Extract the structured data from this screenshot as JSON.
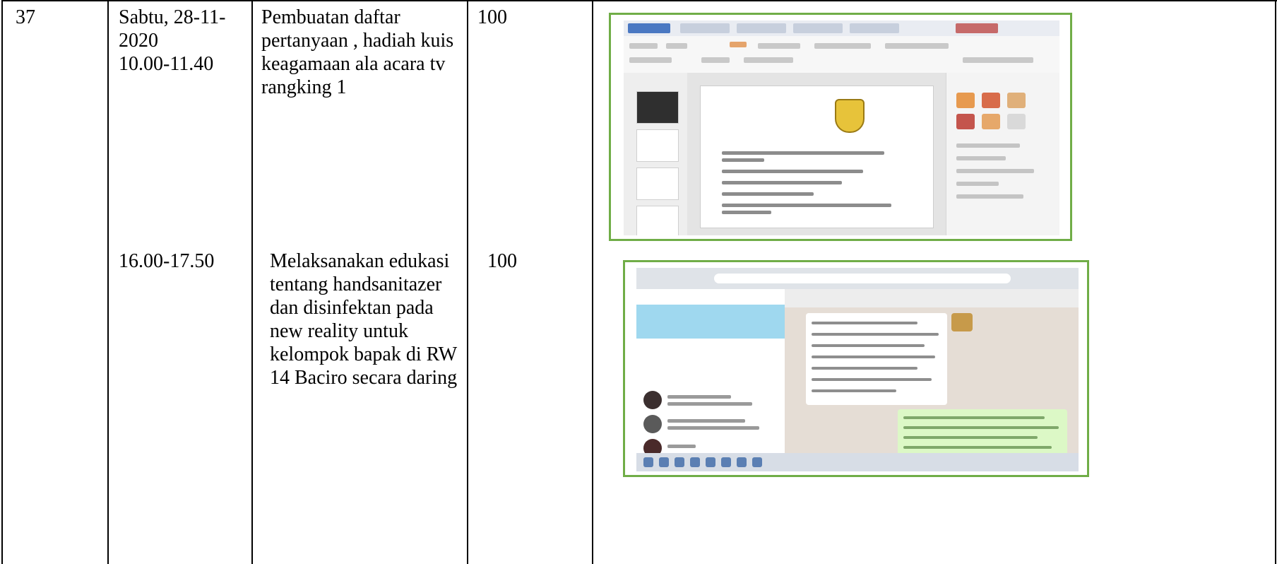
{
  "rows": [
    {
      "number": "37",
      "date_time": "Sabtu, 28-11-\n2020\n10.00-11.40",
      "activity": "Pembuatan daftar\npertanyaan , hadiah kuis\nkeagamaan ala acara tv\nrangking 1",
      "score": "100",
      "evidence": "presentation-editor-screenshot"
    },
    {
      "number": "",
      "date_time": "16.00-17.50",
      "activity": "Melaksanakan edukasi\ntentang handsanitazer\ndan   disinfektan pada\nnew reality untuk\nkelompok bapak di RW\n14 Baciro secara daring",
      "score": "100",
      "evidence": "chat-app-screenshot"
    }
  ],
  "colors": {
    "frame_border": "#70ad47",
    "grid": "#000000",
    "chat_banner": "#9fd8ef",
    "chat_bubble_out": "#dcf8c6",
    "emblem": "#e7c33a"
  }
}
